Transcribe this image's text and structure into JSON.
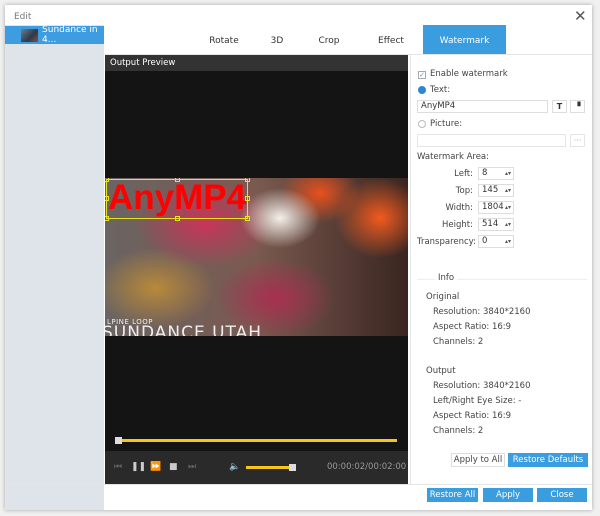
{
  "window": {
    "title": "Edit"
  },
  "sidebar": {
    "items": [
      {
        "label": "Sundance in 4..."
      }
    ]
  },
  "tabs": [
    {
      "label": "Rotate"
    },
    {
      "label": "3D"
    },
    {
      "label": "Crop"
    },
    {
      "label": "Effect"
    },
    {
      "label": "Watermark",
      "active": true
    }
  ],
  "preview": {
    "title": "Output Preview",
    "watermark_text": "AnyMP4",
    "video_caption_1": "LPINE LOOP",
    "video_caption_2": "SUNDANCE UTAH",
    "progress": 0.0,
    "volume": 0.9,
    "time": "00:00:02/00:02:00"
  },
  "watermark": {
    "enable_label": "Enable watermark",
    "enabled": true,
    "text_label": "Text:",
    "text_value": "AnyMP4",
    "picture_label": "Picture:",
    "picture_value": "",
    "browse_label": "···",
    "area_label": "Watermark Area:",
    "fields": [
      {
        "label": "Left:",
        "value": "8"
      },
      {
        "label": "Top:",
        "value": "145"
      },
      {
        "label": "Width:",
        "value": "1804"
      },
      {
        "label": "Height:",
        "value": "514"
      }
    ],
    "transparency_label": "Transparency:",
    "transparency_value": "0",
    "font_btn": "T",
    "color_btn": "▝"
  },
  "info": {
    "title": "Info",
    "original": {
      "title": "Original",
      "lines": [
        "Resolution: 3840*2160",
        "Aspect Ratio: 16:9",
        "Channels: 2"
      ]
    },
    "output": {
      "title": "Output",
      "lines": [
        "Resolution: 3840*2160",
        "Left/Right Eye Size: -",
        "Aspect Ratio: 16:9",
        "Channels: 2"
      ]
    }
  },
  "buttons": {
    "apply_all": "Apply to All",
    "restore_defaults": "Restore Defaults",
    "restore_all": "Restore All",
    "apply": "Apply",
    "close": "Close"
  },
  "colors": {
    "accent": "#3a9de0",
    "progress": "#f5c518",
    "watermark": "#ff0000"
  }
}
